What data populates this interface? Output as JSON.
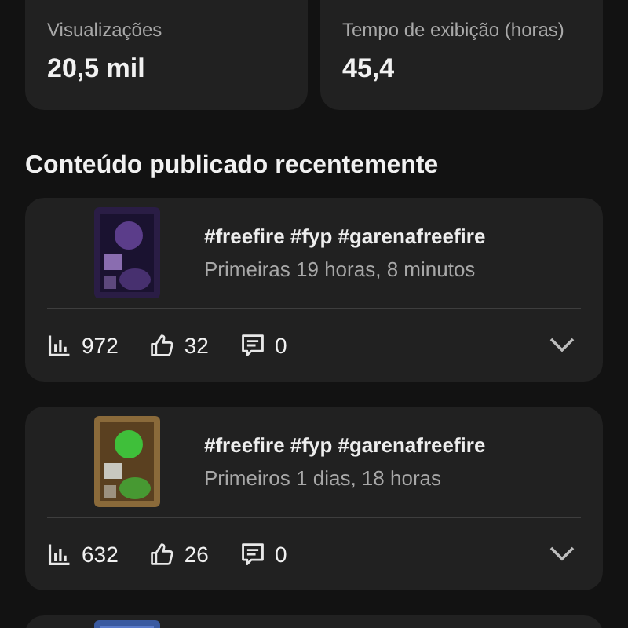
{
  "stats": [
    {
      "label": "Visualizações",
      "value": "20,5 mil"
    },
    {
      "label": "Tempo de exibição (horas)",
      "value": "45,4"
    }
  ],
  "section_title": "Conteúdo publicado recentemente",
  "posts": [
    {
      "title": "#freefire #fyp #garenafreefire",
      "subtitle": "Primeiras 19 horas, 8 minutos",
      "views": "972",
      "likes": "32",
      "comments": "0"
    },
    {
      "title": "#freefire #fyp #garenafreefire",
      "subtitle": "Primeiros 1 dias, 18 horas",
      "views": "632",
      "likes": "26",
      "comments": "0"
    }
  ]
}
